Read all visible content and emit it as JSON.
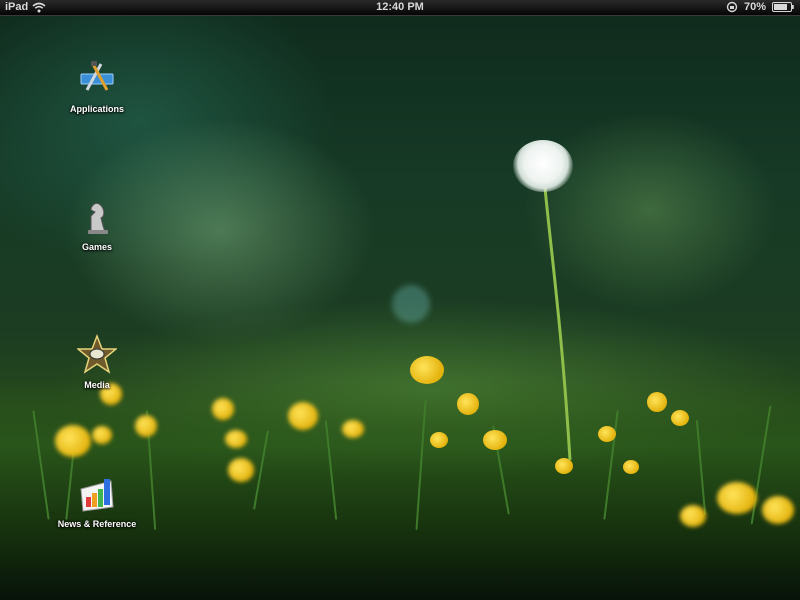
{
  "status_bar": {
    "device": "iPad",
    "time": "12:40 PM",
    "battery": "70%"
  },
  "home_screen": {
    "items": [
      {
        "label": "Applications",
        "icon": "applications-folder-icon"
      },
      {
        "label": "Games",
        "icon": "chess-knight-icon"
      },
      {
        "label": "Media",
        "icon": "star-film-icon"
      },
      {
        "label": "News & Reference",
        "icon": "bar-chart-icon"
      }
    ]
  },
  "colors": {
    "status_bar_bg": "#000000",
    "wallpaper_green": "#1c3d22",
    "flower_yellow": "#f2c618"
  }
}
